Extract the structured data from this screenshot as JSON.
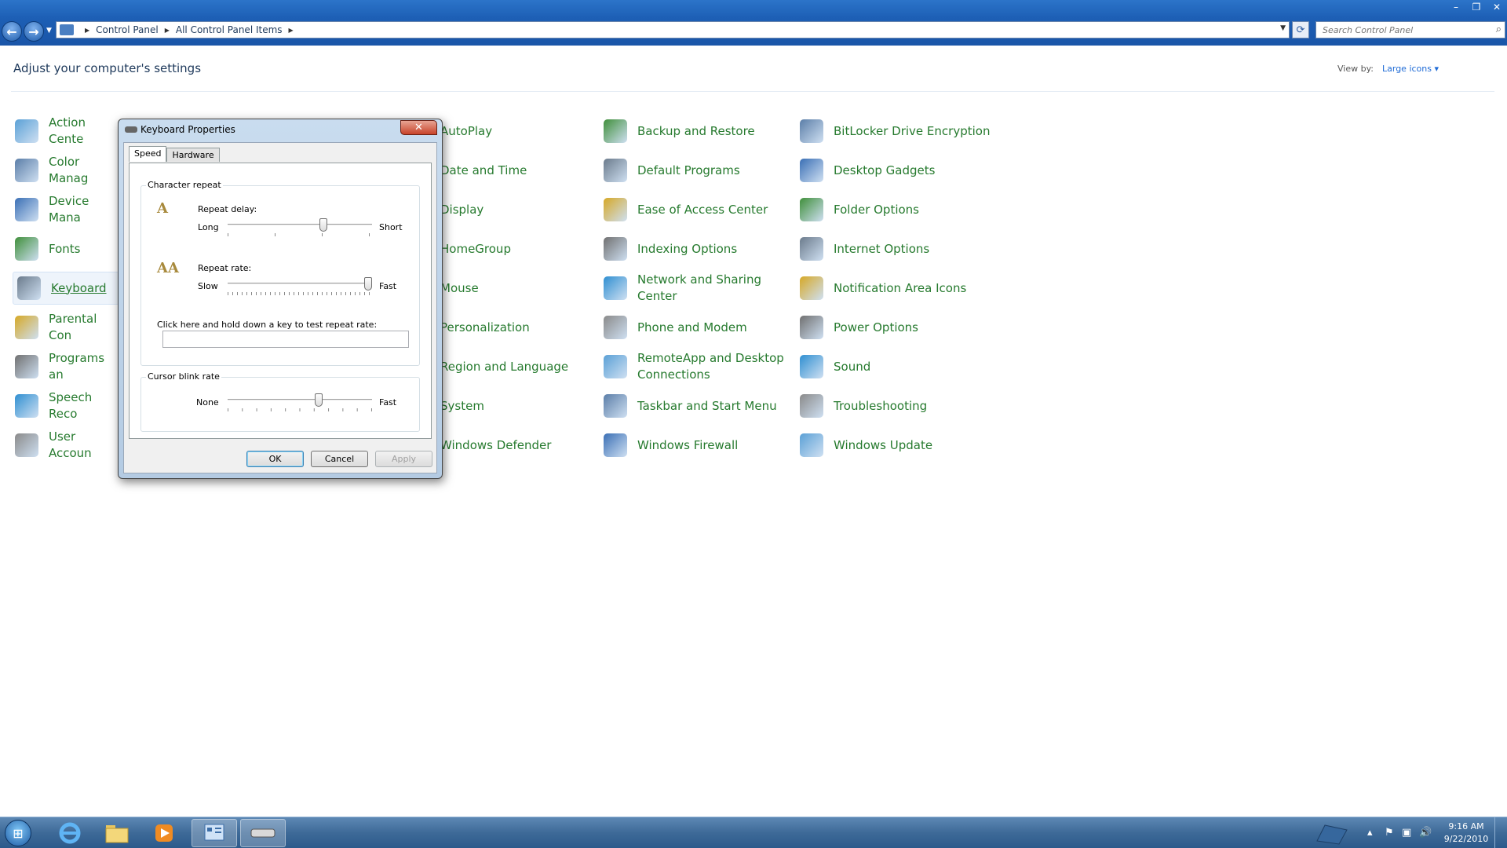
{
  "window": {
    "controls": {
      "minimize": "–",
      "restore": "❐",
      "close": "✕"
    }
  },
  "address_bar": {
    "crumbs": [
      "Control Panel",
      "All Control Panel Items"
    ],
    "search_placeholder": "Search Control Panel"
  },
  "content": {
    "heading": "Adjust your computer's settings",
    "view_by_label": "View by:",
    "view_by_value": "Large icons ▾"
  },
  "items": {
    "col1": [
      "Action Cente",
      "Color Manag",
      "Device Mana",
      "Fonts",
      "Keyboard",
      "Parental Con",
      "Programs an",
      "Speech Reco",
      "User Accoun"
    ],
    "col3": [
      "AutoPlay",
      "Date and Time",
      "Display",
      "HomeGroup",
      "Mouse",
      "Personalization",
      "Region and Language",
      "System",
      "Windows Defender"
    ],
    "col4": [
      "Backup and Restore",
      "Default Programs",
      "Ease of Access Center",
      "Indexing Options",
      "Network and Sharing Center",
      "Phone and Modem",
      "RemoteApp and Desktop Connections",
      "Taskbar and Start Menu",
      "Windows Firewall"
    ],
    "col5": [
      "BitLocker Drive Encryption",
      "Desktop Gadgets",
      "Folder Options",
      "Internet Options",
      "Notification Area Icons",
      "Power Options",
      "Sound",
      "Troubleshooting",
      "Windows Update"
    ],
    "selected": "Keyboard"
  },
  "dialog": {
    "title": "Keyboard Properties",
    "close": "✕",
    "tabs": [
      "Speed",
      "Hardware"
    ],
    "char_repeat_group": "Character repeat",
    "repeat_delay_label": "Repeat delay:",
    "repeat_delay_min": "Long",
    "repeat_delay_max": "Short",
    "repeat_delay_value": 0.67,
    "repeat_rate_label": "Repeat rate:",
    "repeat_rate_min": "Slow",
    "repeat_rate_max": "Fast",
    "repeat_rate_value": 1.0,
    "test_label": "Click here and hold down a key to test repeat rate:",
    "cursor_group": "Cursor blink rate",
    "cursor_min": "None",
    "cursor_max": "Fast",
    "cursor_value": 0.64,
    "ok": "OK",
    "cancel": "Cancel",
    "apply": "Apply"
  },
  "taskbar": {
    "time": "9:16 AM",
    "date": "9/22/2010"
  },
  "colors": {
    "link_green": "#267a2e",
    "accent_blue": "#1f6bd6",
    "taskbar": "#3e6a98"
  }
}
